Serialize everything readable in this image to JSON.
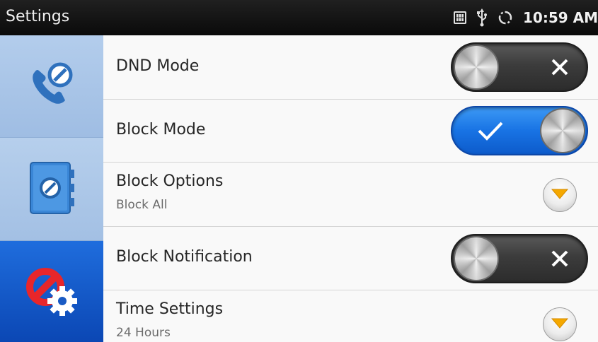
{
  "statusbar": {
    "title": "Settings",
    "clock": "10:59 AM",
    "icons": [
      "sim-card-icon",
      "usb-icon",
      "sync-icon"
    ]
  },
  "sidebar": {
    "tabs": [
      {
        "name": "calls",
        "icon": "phone-block-icon"
      },
      {
        "name": "contacts",
        "icon": "blocked-contacts-icon"
      },
      {
        "name": "block-settings",
        "icon": "block-settings-gear-icon",
        "selected": true
      }
    ]
  },
  "settings": {
    "dnd_mode": {
      "label": "DND Mode",
      "state": "off"
    },
    "block_mode": {
      "label": "Block Mode",
      "state": "on"
    },
    "block_options": {
      "label": "Block Options",
      "value": "Block All"
    },
    "block_notification": {
      "label": "Block Notification",
      "state": "off"
    },
    "time_settings": {
      "label": "Time Settings",
      "value": "24 Hours"
    }
  },
  "colors": {
    "accent_blue": "#1873e4",
    "sidebar_light": "#a3c0e4",
    "sidebar_selected": "#0b47b4",
    "dropdown_arrow": "#f5a800",
    "statusbar": "#111111"
  }
}
